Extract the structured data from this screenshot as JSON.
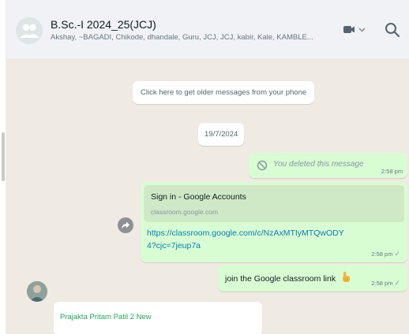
{
  "header": {
    "title": "B.Sc.-I 2024_25(JCJ)",
    "members": "Akshay, ~BAGADI, Chikode, dhandale, Guru, JCJ, JCJ, kabir, Kale, KAMBLE...",
    "icons": {
      "avatar": "group-avatar-icon",
      "video": "video-call-icon",
      "search": "search-icon"
    }
  },
  "chat": {
    "info_pill": "Click here to get older messages from your phone",
    "date_pill": "19/7/2024",
    "deleted_message": {
      "text": "You deleted this message",
      "time": "2:58 pm"
    },
    "link_message": {
      "preview_title": "Sign in - Google Accounts",
      "preview_domain": "classroom.google.com",
      "url": "https://classroom.google.com/c/NzAxMTIyMTQwODY4?cjc=7jeup7a",
      "time": "2:58 pm",
      "status_icon": "check-icon"
    },
    "join_message": {
      "text": "join the Google classroom link",
      "emoji": "👇",
      "time": "2:58 pm",
      "status_icon": "check-icon"
    },
    "incoming_message": {
      "sender": "Prajakta Pritam Patil 2 New"
    }
  },
  "colors": {
    "outgoing_bubble": "#d9fdd3",
    "chat_background": "#efeae2",
    "header_background": "#f0f2f5",
    "link": "#027eb5",
    "sender_name": "#1fa855"
  }
}
